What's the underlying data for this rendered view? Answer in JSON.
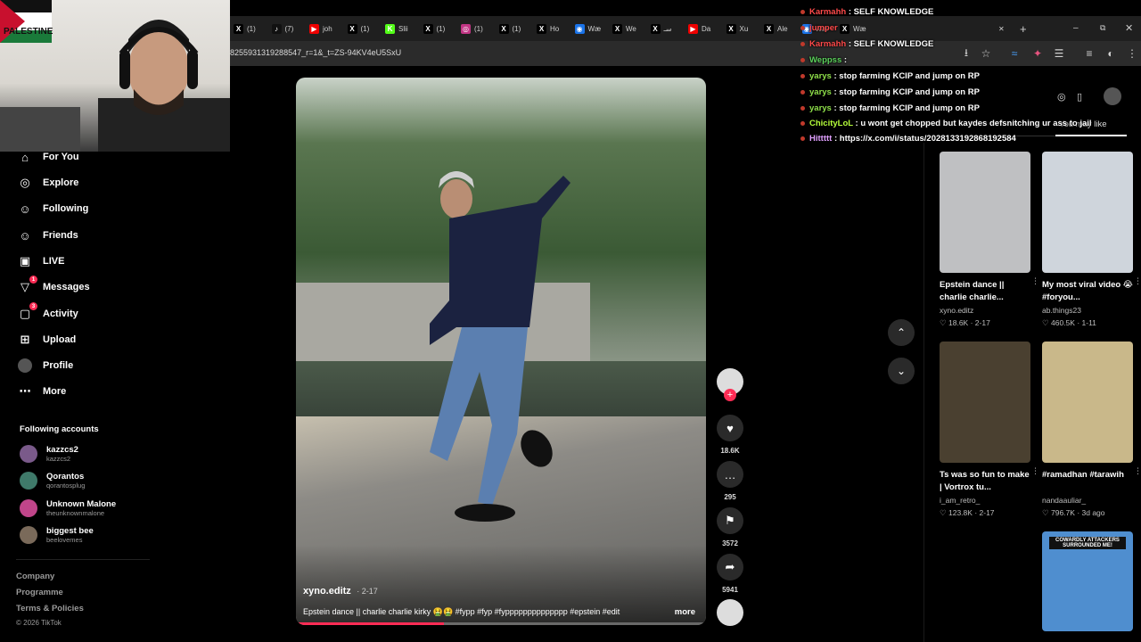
{
  "browser": {
    "tabs": [
      {
        "label": "(1)",
        "icon": "x-icon",
        "color": "#000"
      },
      {
        "label": "(7)",
        "icon": "tiktok-icon",
        "color": "#111"
      },
      {
        "label": "joh",
        "icon": "youtube-icon",
        "color": "#e00"
      },
      {
        "label": "(1)",
        "icon": "x-icon",
        "color": "#000"
      },
      {
        "label": "Slii",
        "icon": "kick-icon",
        "color": "#53fc18"
      },
      {
        "label": "(1)",
        "icon": "x-icon",
        "color": "#000"
      },
      {
        "label": "(1)",
        "icon": "instagram-icon",
        "color": "#c13584"
      },
      {
        "label": "(1)",
        "icon": "x-icon",
        "color": "#000"
      },
      {
        "label": "Ho",
        "icon": "x-icon",
        "color": "#000"
      },
      {
        "label": "Wæ",
        "icon": "globe-icon",
        "color": "#1a73e8"
      },
      {
        "label": "We",
        "icon": "x-icon",
        "color": "#000"
      },
      {
        "label": "سـ",
        "icon": "x-icon",
        "color": "#000"
      },
      {
        "label": "Da",
        "icon": "youtube-icon",
        "color": "#e00"
      },
      {
        "label": "Xu",
        "icon": "x-icon",
        "color": "#000"
      },
      {
        "label": "Ale",
        "icon": "x-icon",
        "color": "#000"
      },
      {
        "label": "Wæ",
        "icon": "globe-icon",
        "color": "#1a73e8"
      },
      {
        "label": "Wæ",
        "icon": "x-icon",
        "color": "#000"
      }
    ],
    "new_tab": "+",
    "url": "8255931319288547_r=1&_t=ZS-94KV4eU5SxU"
  },
  "webcam": {
    "flag_text": "PALESTINE"
  },
  "sidebar": {
    "nav": [
      {
        "label": "For You",
        "icon": "home-icon",
        "glyph": "⌂"
      },
      {
        "label": "Explore",
        "icon": "compass-icon",
        "glyph": "◎"
      },
      {
        "label": "Following",
        "icon": "following-icon",
        "glyph": "☺"
      },
      {
        "label": "Friends",
        "icon": "friends-icon",
        "glyph": "☺"
      },
      {
        "label": "LIVE",
        "icon": "live-icon",
        "glyph": "▣"
      },
      {
        "label": "Messages",
        "icon": "messages-icon",
        "glyph": "▽",
        "badge": "1"
      },
      {
        "label": "Activity",
        "icon": "activity-icon",
        "glyph": "▢",
        "badge": "3"
      },
      {
        "label": "Upload",
        "icon": "upload-icon",
        "glyph": "⊞"
      },
      {
        "label": "Profile",
        "icon": "profile-avatar-icon",
        "glyph": "●"
      },
      {
        "label": "More",
        "icon": "more-icon",
        "glyph": "⋯"
      }
    ],
    "following_title": "Following accounts",
    "following": [
      {
        "name": "kazzcs2",
        "handle": "kazzcs2",
        "color": "#7a5a8a"
      },
      {
        "name": "Qorantos",
        "handle": "qorantosplug",
        "color": "#3f7a6a"
      },
      {
        "name": "Unknown Malone",
        "handle": "theunknownmalone",
        "color": "#c0458a"
      },
      {
        "name": "biggest bee",
        "handle": "beelovemes",
        "color": "#7a6a5a"
      }
    ],
    "footer": [
      "Company",
      "Programme",
      "Terms & Policies"
    ],
    "copyright": "© 2026 TikTok"
  },
  "video": {
    "author": "xyno.editz",
    "date": "2-17",
    "caption": "Epstein dance || charlie charlie kirky 🤮🤮 #fypp #fyp #fypppppppppppppp #epstein #edit",
    "more": "more",
    "progress": 0.36
  },
  "actions": [
    {
      "name": "avatar",
      "glyph": "",
      "count": ""
    },
    {
      "name": "like",
      "glyph": "♥",
      "count": "18.6K"
    },
    {
      "name": "comment",
      "glyph": "…",
      "count": "295"
    },
    {
      "name": "bookmark",
      "glyph": "⚑",
      "count": "3572"
    },
    {
      "name": "share",
      "glyph": "➦",
      "count": "5941"
    }
  ],
  "nav_arrows": {
    "up": "⌃",
    "down": "⌄"
  },
  "chat": [
    {
      "user": "Karmahh",
      "msg": " : SELF KNOWLEDGE",
      "color": "#ff4a4a"
    },
    {
      "user": "jumper",
      "msg": "",
      "color": "#ff4a4a"
    },
    {
      "user": "Karmahh",
      "msg": " : SELF KNOWLEDGE",
      "color": "#ff4a4a"
    },
    {
      "user": "Weppss",
      "msg": " :",
      "color": "#5dd35d"
    },
    {
      "user": "yarys",
      "msg": " : stop farming KCIP and jump on RP",
      "color": "#8fe04a"
    },
    {
      "user": "yarys",
      "msg": " : stop farming KCIP and jump on RP",
      "color": "#8fe04a"
    },
    {
      "user": "yarys",
      "msg": " : stop farming KCIP and jump on RP",
      "color": "#8fe04a"
    },
    {
      "user": "ChicityLoL",
      "msg": " : u wont get chopped but kaydes defsnitching ur ass to jail",
      "color": "#b6ff3b"
    },
    {
      "user": "Hittttt",
      "msg": " : https://x.com/i/status/2028133192868192584",
      "color": "#e0a0ff"
    }
  ],
  "right_panel": {
    "tab_you_may_like": "You may like",
    "videos": [
      {
        "title": "Epstein dance || charlie charlie...",
        "author": "xyno.editz",
        "likes": "18.6K",
        "date": "2-17",
        "bg": "#bfc0c2"
      },
      {
        "title": "My most viral video 😭 #foryou...",
        "author": "ab.things23",
        "likes": "460.5K",
        "date": "1-11",
        "bg": "#cfd5dc"
      },
      {
        "title": "Ts was so fun to make | Vortrox tu...",
        "author": "i_am_retro_",
        "likes": "123.8K",
        "date": "2-17",
        "bg": "#4a4030"
      },
      {
        "title": "#ramadhan #tarawih",
        "author": "nandaauliar_",
        "likes": "796.7K",
        "date": "3d ago",
        "bg": "#c9b88a"
      },
      {
        "title": "COWARDLY ATTACKERS SURROUNDED ME!",
        "author": "",
        "likes": "",
        "date": "",
        "bg": "#4f8ecf"
      }
    ],
    "heart": "♡"
  }
}
